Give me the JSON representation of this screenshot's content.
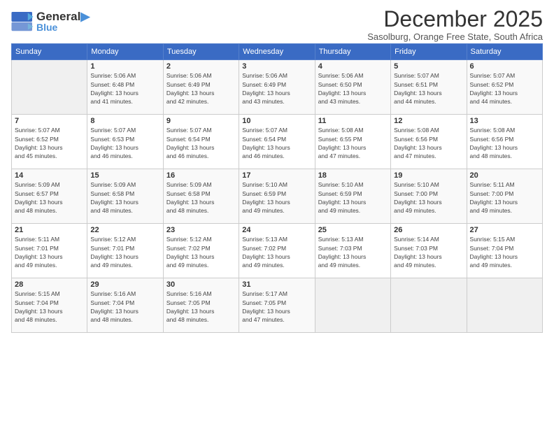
{
  "header": {
    "logo_line1": "General",
    "logo_line2": "Blue",
    "title": "December 2025",
    "subtitle": "Sasolburg, Orange Free State, South Africa"
  },
  "weekdays": [
    "Sunday",
    "Monday",
    "Tuesday",
    "Wednesday",
    "Thursday",
    "Friday",
    "Saturday"
  ],
  "weeks": [
    [
      {
        "day": "",
        "info": ""
      },
      {
        "day": "1",
        "info": "Sunrise: 5:06 AM\nSunset: 6:48 PM\nDaylight: 13 hours\nand 41 minutes."
      },
      {
        "day": "2",
        "info": "Sunrise: 5:06 AM\nSunset: 6:49 PM\nDaylight: 13 hours\nand 42 minutes."
      },
      {
        "day": "3",
        "info": "Sunrise: 5:06 AM\nSunset: 6:49 PM\nDaylight: 13 hours\nand 43 minutes."
      },
      {
        "day": "4",
        "info": "Sunrise: 5:06 AM\nSunset: 6:50 PM\nDaylight: 13 hours\nand 43 minutes."
      },
      {
        "day": "5",
        "info": "Sunrise: 5:07 AM\nSunset: 6:51 PM\nDaylight: 13 hours\nand 44 minutes."
      },
      {
        "day": "6",
        "info": "Sunrise: 5:07 AM\nSunset: 6:52 PM\nDaylight: 13 hours\nand 44 minutes."
      }
    ],
    [
      {
        "day": "7",
        "info": "Sunrise: 5:07 AM\nSunset: 6:52 PM\nDaylight: 13 hours\nand 45 minutes."
      },
      {
        "day": "8",
        "info": "Sunrise: 5:07 AM\nSunset: 6:53 PM\nDaylight: 13 hours\nand 46 minutes."
      },
      {
        "day": "9",
        "info": "Sunrise: 5:07 AM\nSunset: 6:54 PM\nDaylight: 13 hours\nand 46 minutes."
      },
      {
        "day": "10",
        "info": "Sunrise: 5:07 AM\nSunset: 6:54 PM\nDaylight: 13 hours\nand 46 minutes."
      },
      {
        "day": "11",
        "info": "Sunrise: 5:08 AM\nSunset: 6:55 PM\nDaylight: 13 hours\nand 47 minutes."
      },
      {
        "day": "12",
        "info": "Sunrise: 5:08 AM\nSunset: 6:56 PM\nDaylight: 13 hours\nand 47 minutes."
      },
      {
        "day": "13",
        "info": "Sunrise: 5:08 AM\nSunset: 6:56 PM\nDaylight: 13 hours\nand 48 minutes."
      }
    ],
    [
      {
        "day": "14",
        "info": "Sunrise: 5:09 AM\nSunset: 6:57 PM\nDaylight: 13 hours\nand 48 minutes."
      },
      {
        "day": "15",
        "info": "Sunrise: 5:09 AM\nSunset: 6:58 PM\nDaylight: 13 hours\nand 48 minutes."
      },
      {
        "day": "16",
        "info": "Sunrise: 5:09 AM\nSunset: 6:58 PM\nDaylight: 13 hours\nand 48 minutes."
      },
      {
        "day": "17",
        "info": "Sunrise: 5:10 AM\nSunset: 6:59 PM\nDaylight: 13 hours\nand 49 minutes."
      },
      {
        "day": "18",
        "info": "Sunrise: 5:10 AM\nSunset: 6:59 PM\nDaylight: 13 hours\nand 49 minutes."
      },
      {
        "day": "19",
        "info": "Sunrise: 5:10 AM\nSunset: 7:00 PM\nDaylight: 13 hours\nand 49 minutes."
      },
      {
        "day": "20",
        "info": "Sunrise: 5:11 AM\nSunset: 7:00 PM\nDaylight: 13 hours\nand 49 minutes."
      }
    ],
    [
      {
        "day": "21",
        "info": "Sunrise: 5:11 AM\nSunset: 7:01 PM\nDaylight: 13 hours\nand 49 minutes."
      },
      {
        "day": "22",
        "info": "Sunrise: 5:12 AM\nSunset: 7:01 PM\nDaylight: 13 hours\nand 49 minutes."
      },
      {
        "day": "23",
        "info": "Sunrise: 5:12 AM\nSunset: 7:02 PM\nDaylight: 13 hours\nand 49 minutes."
      },
      {
        "day": "24",
        "info": "Sunrise: 5:13 AM\nSunset: 7:02 PM\nDaylight: 13 hours\nand 49 minutes."
      },
      {
        "day": "25",
        "info": "Sunrise: 5:13 AM\nSunset: 7:03 PM\nDaylight: 13 hours\nand 49 minutes."
      },
      {
        "day": "26",
        "info": "Sunrise: 5:14 AM\nSunset: 7:03 PM\nDaylight: 13 hours\nand 49 minutes."
      },
      {
        "day": "27",
        "info": "Sunrise: 5:15 AM\nSunset: 7:04 PM\nDaylight: 13 hours\nand 49 minutes."
      }
    ],
    [
      {
        "day": "28",
        "info": "Sunrise: 5:15 AM\nSunset: 7:04 PM\nDaylight: 13 hours\nand 48 minutes."
      },
      {
        "day": "29",
        "info": "Sunrise: 5:16 AM\nSunset: 7:04 PM\nDaylight: 13 hours\nand 48 minutes."
      },
      {
        "day": "30",
        "info": "Sunrise: 5:16 AM\nSunset: 7:05 PM\nDaylight: 13 hours\nand 48 minutes."
      },
      {
        "day": "31",
        "info": "Sunrise: 5:17 AM\nSunset: 7:05 PM\nDaylight: 13 hours\nand 47 minutes."
      },
      {
        "day": "",
        "info": ""
      },
      {
        "day": "",
        "info": ""
      },
      {
        "day": "",
        "info": ""
      }
    ]
  ]
}
